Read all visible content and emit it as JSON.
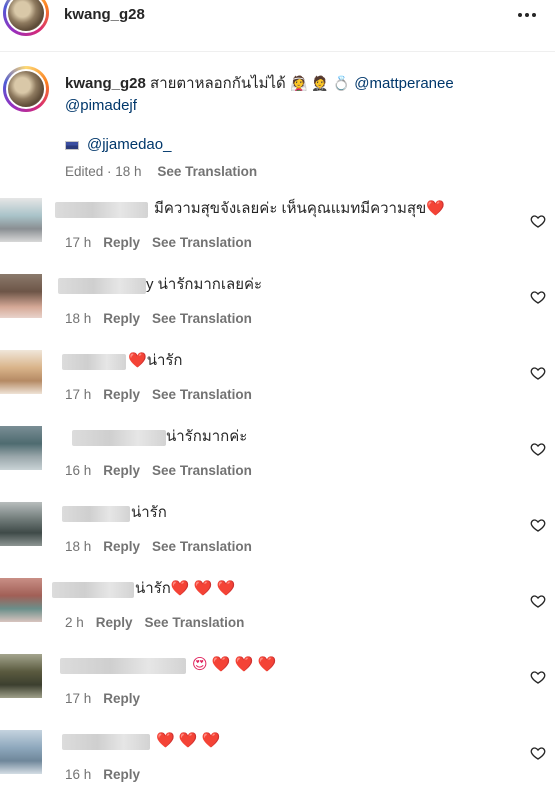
{
  "header": {
    "username": "kwang_g28",
    "more_icon": "more-horizontal-icon"
  },
  "caption": {
    "username": "kwang_g28",
    "text": "สายตาหลอกกันไม่ได้",
    "emojis": "👰 🤵 💍",
    "mention_1": "@mattperanee",
    "mention_2": "@pimadejf",
    "mention_3": "@jjamedao_",
    "time": "Edited · 18 h",
    "see_translation": "See Translation"
  },
  "comments": [
    {
      "text": "มีความสุขจังเลยค่ะ เห็นคุณแมทมีความสุข",
      "hearts": "❤️",
      "time": "17 h",
      "reply": "Reply",
      "see_translation": "See Translation"
    },
    {
      "text": "y น่ารักมากเลยค่ะ",
      "hearts": "",
      "time": "18 h",
      "reply": "Reply",
      "see_translation": "See Translation"
    },
    {
      "text": "น่ารัก",
      "hearts": "❤️",
      "time": "17 h",
      "reply": "Reply",
      "see_translation": "See Translation"
    },
    {
      "text": "น่ารักมากค่ะ",
      "hearts": "",
      "time": "16 h",
      "reply": "Reply",
      "see_translation": "See Translation"
    },
    {
      "text": "น่ารัก",
      "hearts": "",
      "time": "18 h",
      "reply": "Reply",
      "see_translation": "See Translation"
    },
    {
      "text": "น่ารัก",
      "hearts": "❤️ ❤️ ❤️",
      "time": "2 h",
      "reply": "Reply",
      "see_translation": "See Translation"
    },
    {
      "text": "😍 ❤️ ❤️ ❤️",
      "hearts": "",
      "time": "17 h",
      "reply": "Reply",
      "see_translation": ""
    },
    {
      "text": "❤️ ❤️ ❤️",
      "hearts": "",
      "time": "16 h",
      "reply": "Reply",
      "see_translation": ""
    }
  ],
  "colors": {
    "mention": "#00376b",
    "meta": "#737373",
    "heart": "#e0245e"
  }
}
